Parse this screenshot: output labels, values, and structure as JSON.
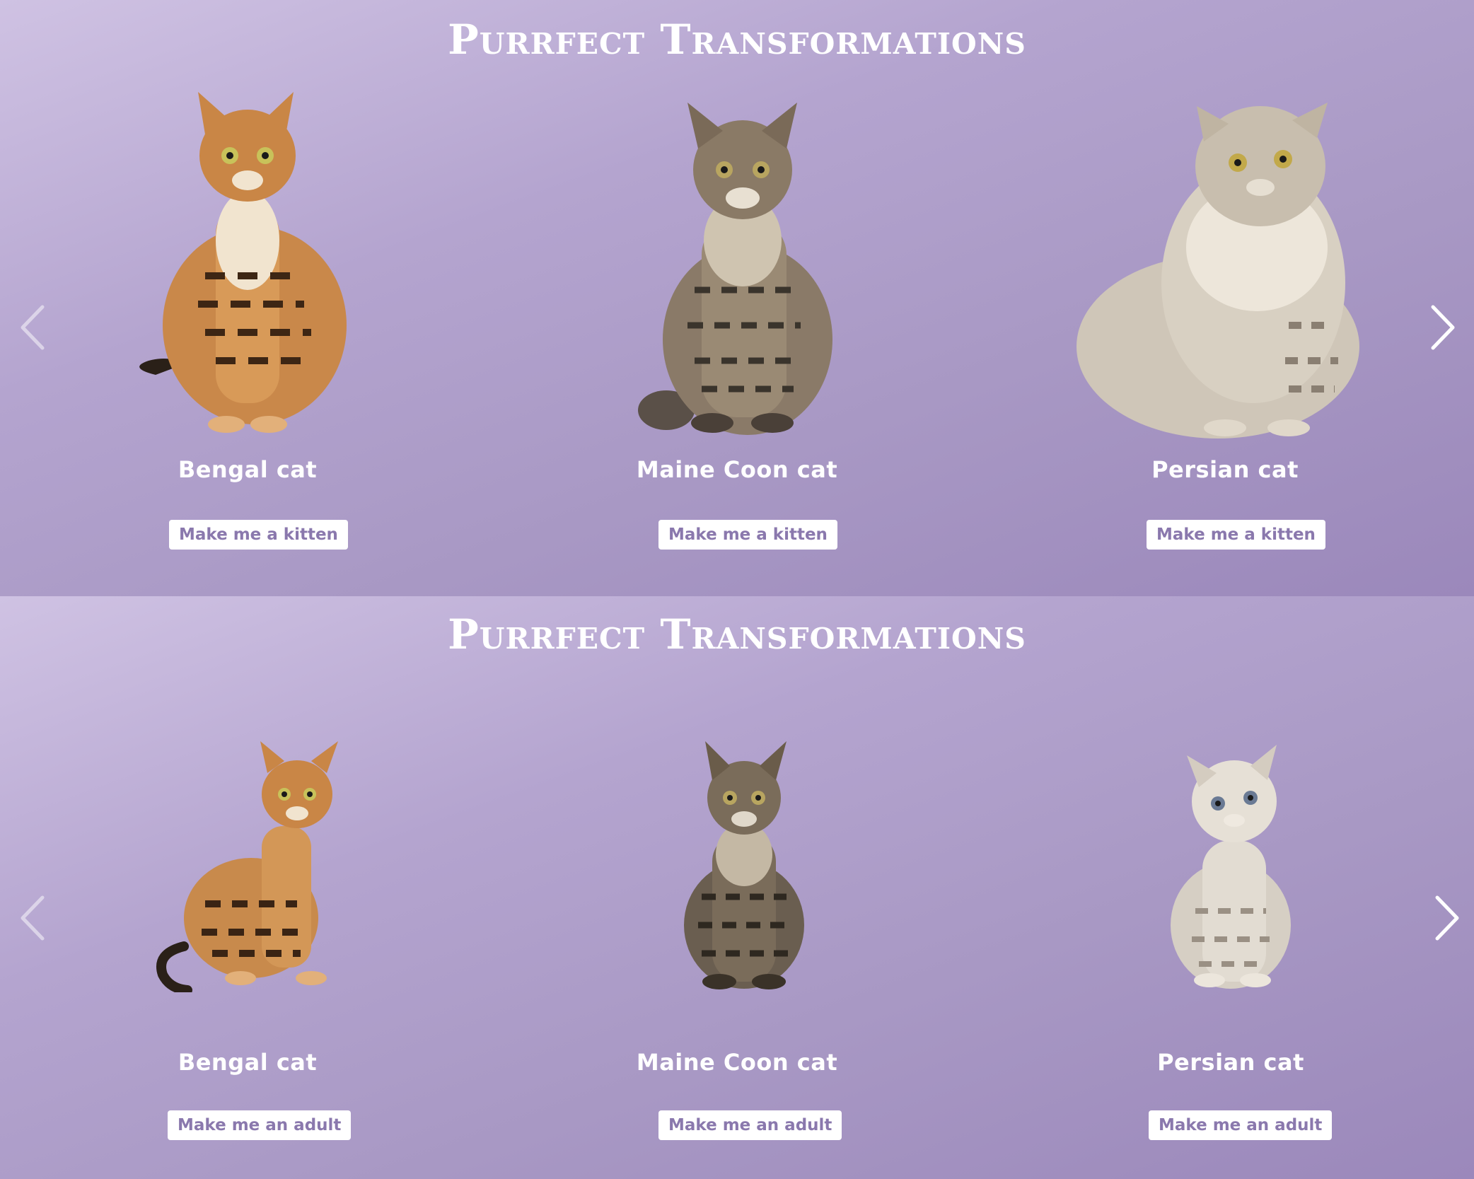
{
  "colors": {
    "background_light": "#cfc2e3",
    "background_dark": "#9b88bb",
    "text": "#ffffff",
    "button_text": "#8a78ad",
    "button_bg": "#ffffff"
  },
  "adult_section": {
    "title": "Purrfect Transformations",
    "prev_icon": "chevron-left-icon",
    "next_icon": "chevron-right-icon",
    "cards": [
      {
        "name": "Bengal cat",
        "button": "Make me a kitten"
      },
      {
        "name": "Maine Coon cat",
        "button": "Make me a kitten"
      },
      {
        "name": "Persian cat",
        "button": "Make me a kitten"
      }
    ]
  },
  "kitten_section": {
    "title": "Purrfect Transformations",
    "prev_icon": "chevron-left-icon",
    "next_icon": "chevron-right-icon",
    "cards": [
      {
        "name": "Bengal cat",
        "button": "Make me an adult"
      },
      {
        "name": "Maine Coon cat",
        "button": "Make me an adult"
      },
      {
        "name": "Persian cat",
        "button": "Make me an adult"
      }
    ]
  }
}
